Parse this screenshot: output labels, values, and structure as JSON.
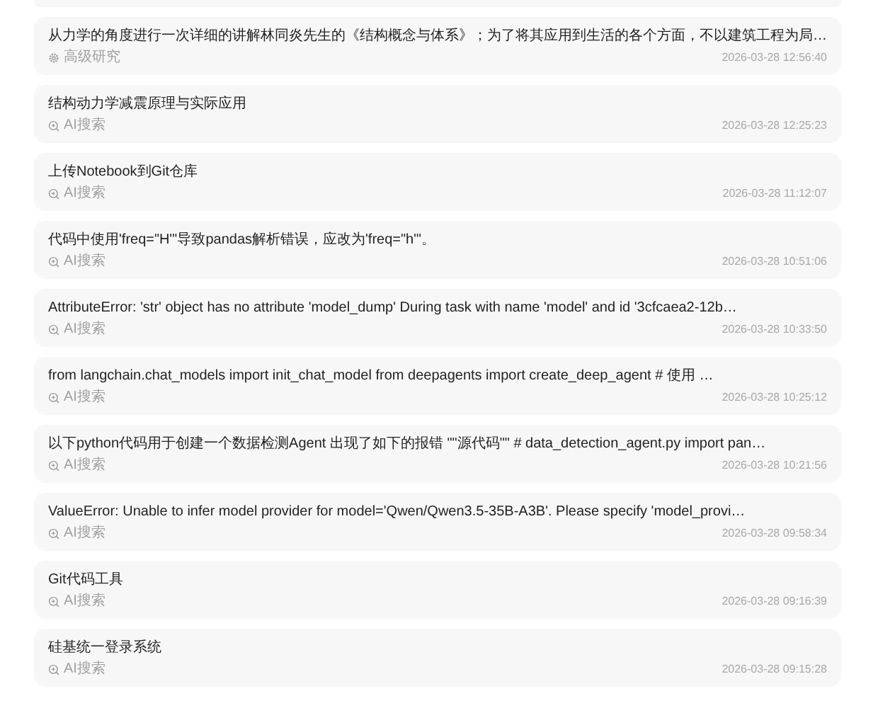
{
  "history": [
    {
      "title": "从力学的角度进行一次详细的讲解林同炎先生的《结构概念与体系》；为了将其应用到生活的各个方面，不以建筑工程为局…",
      "source": {
        "kind": "research",
        "label": "高级研究"
      },
      "time": "2026-03-28 12:56:40"
    },
    {
      "title": "结构动力学减震原理与实际应用",
      "source": {
        "kind": "search",
        "label": "AI搜索"
      },
      "time": "2026-03-28 12:25:23"
    },
    {
      "title": "上传Notebook到Git仓库",
      "source": {
        "kind": "search",
        "label": "AI搜索"
      },
      "time": "2026-03-28 11:12:07"
    },
    {
      "title": "代码中使用'freq=\"H\"'导致pandas解析错误，应改为'freq=\"h\"'。",
      "source": {
        "kind": "search",
        "label": "AI搜索"
      },
      "time": "2026-03-28 10:51:06"
    },
    {
      "title": "AttributeError: 'str' object has no attribute 'model_dump' During task with name 'model' and id '3cfcaea2-12b…",
      "source": {
        "kind": "search",
        "label": "AI搜索"
      },
      "time": "2026-03-28 10:33:50"
    },
    {
      "title": "from langchain.chat_models import init_chat_model from deepagents import create_deep_agent # 使用 …",
      "source": {
        "kind": "search",
        "label": "AI搜索"
      },
      "time": "2026-03-28 10:25:12"
    },
    {
      "title": "以下python代码用于创建一个数据检测Agent 出现了如下的报错 \"\"源代码\"\" # data_detection_agent.py import pan…",
      "source": {
        "kind": "search",
        "label": "AI搜索"
      },
      "time": "2026-03-28 10:21:56"
    },
    {
      "title": "ValueError: Unable to infer model provider for model='Qwen/Qwen3.5-35B-A3B'. Please specify 'model_provi…",
      "source": {
        "kind": "search",
        "label": "AI搜索"
      },
      "time": "2026-03-28 09:58:34"
    },
    {
      "title": "Git代码工具",
      "source": {
        "kind": "search",
        "label": "AI搜索"
      },
      "time": "2026-03-28 09:16:39"
    },
    {
      "title": "硅基统一登录系统",
      "source": {
        "kind": "search",
        "label": "AI搜索"
      },
      "time": "2026-03-28 09:15:28"
    }
  ]
}
